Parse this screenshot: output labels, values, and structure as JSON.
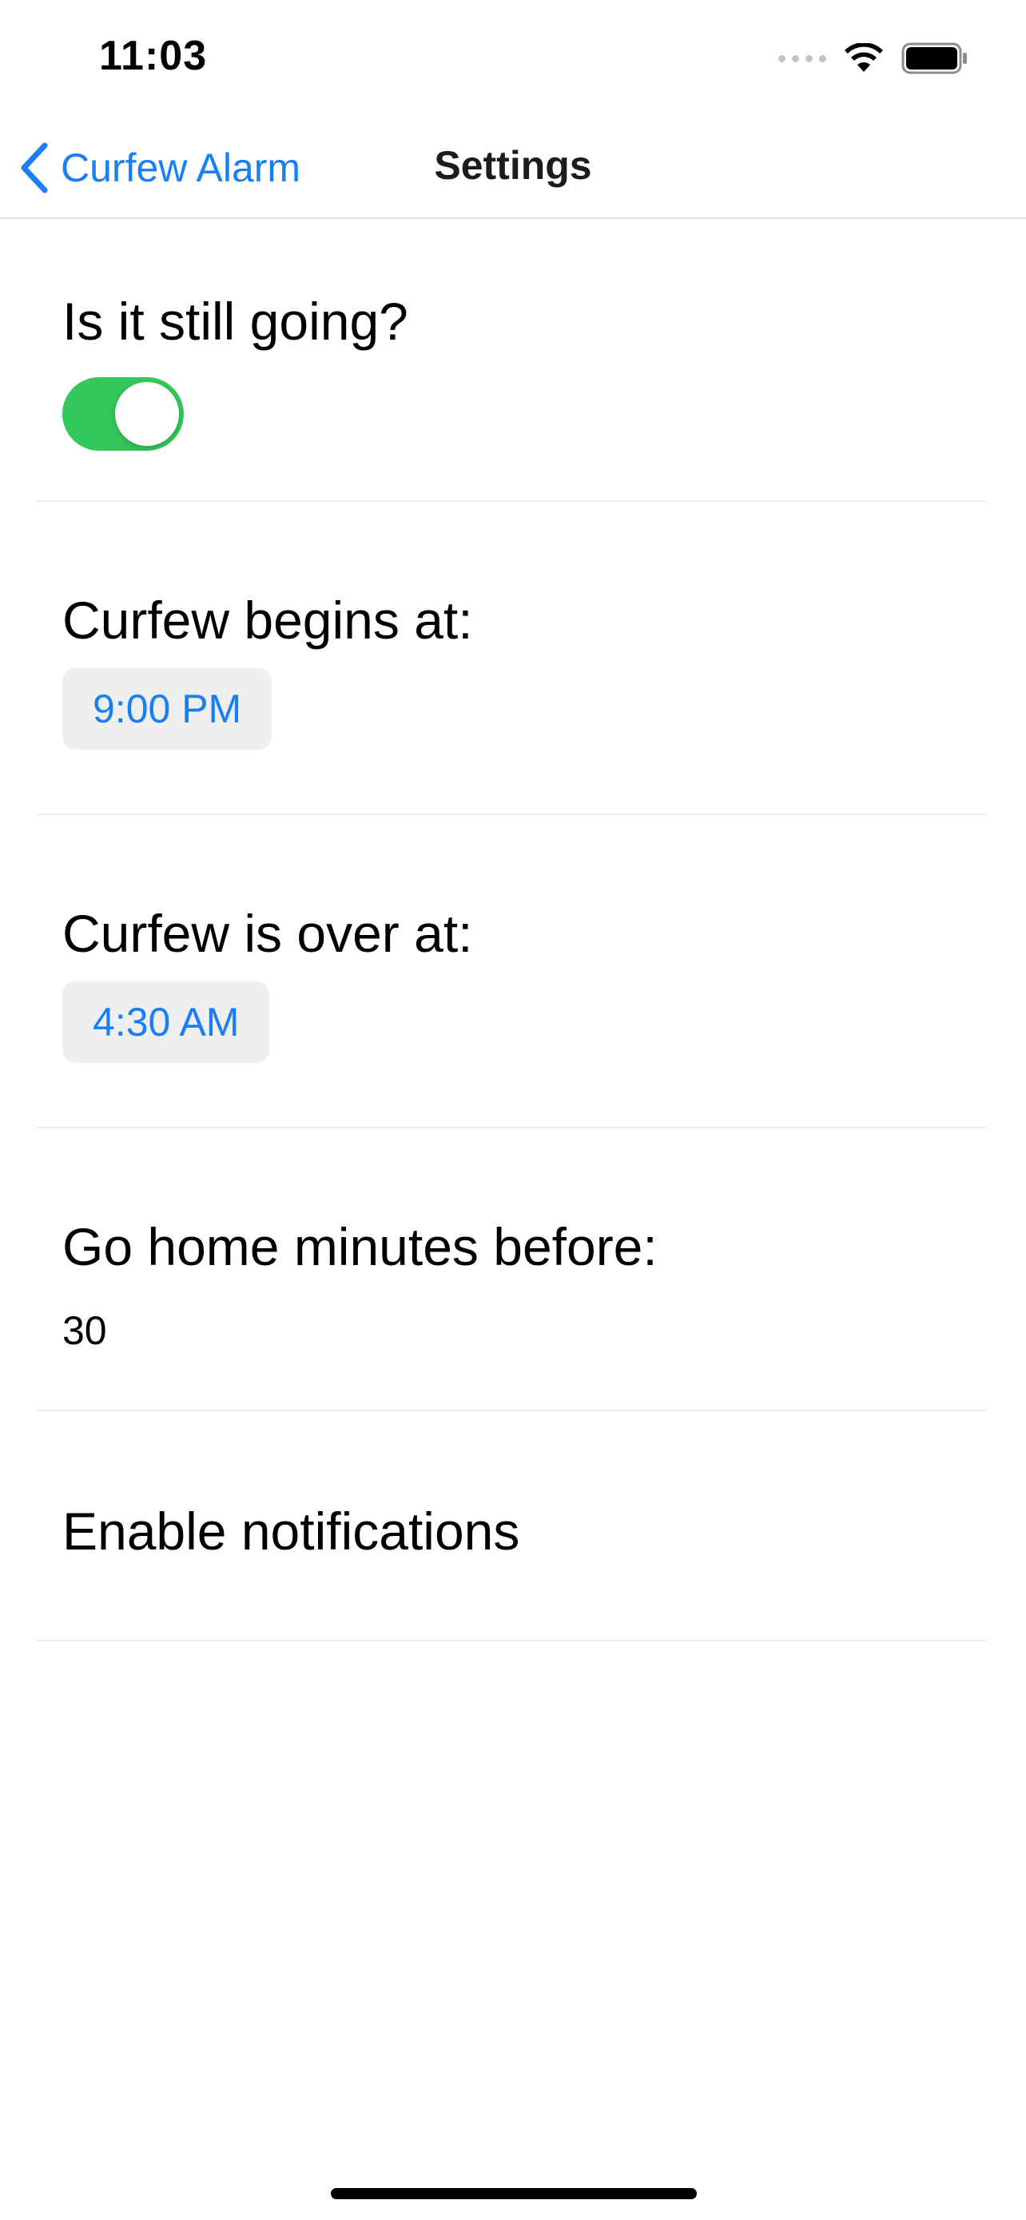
{
  "status_bar": {
    "time": "11:03",
    "icons": [
      "signal-dots-icon",
      "wifi-icon",
      "battery-icon"
    ]
  },
  "nav": {
    "back_label": "Curfew Alarm",
    "title": "Settings"
  },
  "settings": {
    "still_going": {
      "label": "Is it still going?",
      "enabled": true
    },
    "begins": {
      "label": "Curfew begins at:",
      "value": "9:00 PM"
    },
    "over": {
      "label": "Curfew is over at:",
      "value": "4:30 AM"
    },
    "go_home": {
      "label": "Go home minutes before:",
      "value": "30"
    },
    "notifications": {
      "label": "Enable notifications"
    }
  },
  "colors": {
    "accent": "#1a7ef5",
    "toggle_on": "#34c759",
    "pill_bg": "#efeff0"
  }
}
